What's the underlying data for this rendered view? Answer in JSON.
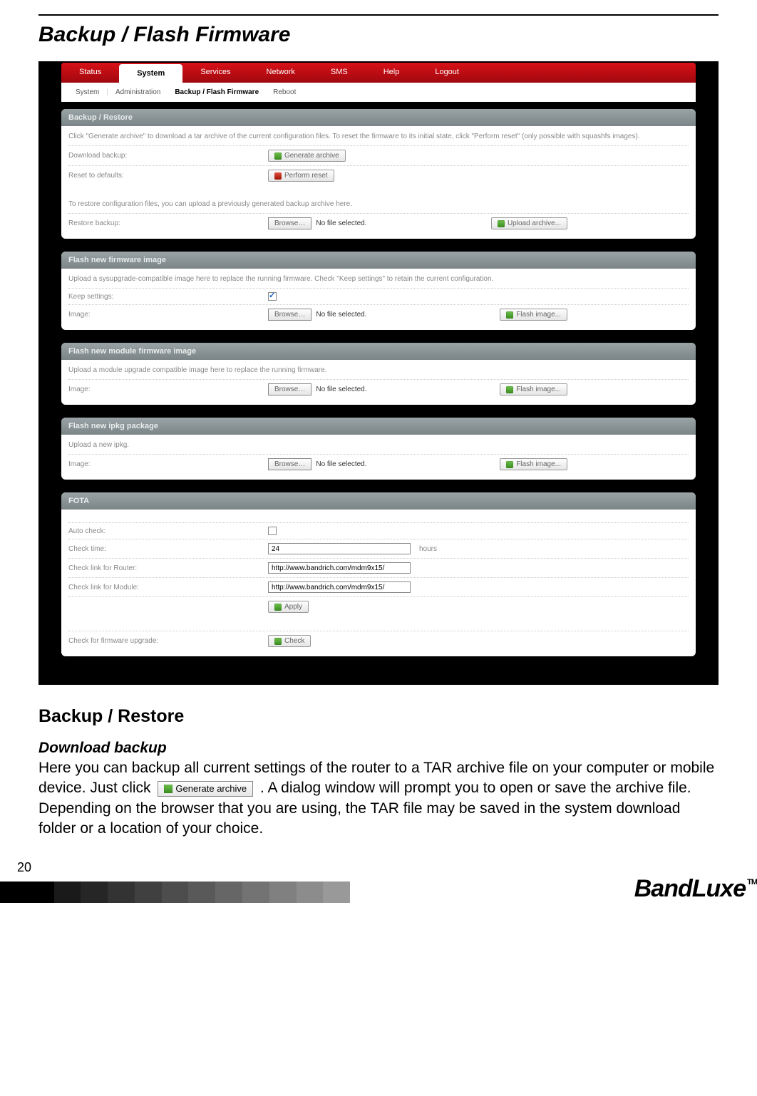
{
  "page": {
    "title": "Backup / Flash Firmware",
    "number": "20"
  },
  "nav": {
    "tabs": [
      "Status",
      "System",
      "Services",
      "Network",
      "SMS",
      "Help",
      "Logout"
    ],
    "active_tab": "System",
    "subtabs": {
      "system": "System",
      "admin": "Administration",
      "backup": "Backup / Flash Firmware",
      "reboot": "Reboot"
    }
  },
  "backup_restore": {
    "head": "Backup / Restore",
    "hint": "Click \"Generate archive\" to download a tar archive of the current configuration files. To reset the firmware to its initial state, click \"Perform reset\" (only possible with squashfs images).",
    "download_label": "Download backup:",
    "generate_btn": "Generate archive",
    "reset_label": "Reset to defaults:",
    "reset_btn": "Perform reset",
    "restore_hint": "To restore configuration files, you can upload a previously generated backup archive here.",
    "restore_label": "Restore backup:",
    "browse": "Browse…",
    "nofile": "No file selected.",
    "upload_btn": "Upload archive..."
  },
  "flash_fw": {
    "head": "Flash new firmware image",
    "hint": "Upload a sysupgrade-compatible image here to replace the running firmware. Check \"Keep settings\" to retain the current configuration.",
    "keep_label": "Keep settings:",
    "image_label": "Image:",
    "browse": "Browse…",
    "nofile": "No file selected.",
    "flash_btn": "Flash image..."
  },
  "flash_module": {
    "head": "Flash new module firmware image",
    "hint": "Upload a module upgrade compatible image here to replace the running firmware.",
    "image_label": "Image:",
    "browse": "Browse…",
    "nofile": "No file selected.",
    "flash_btn": "Flash image..."
  },
  "flash_ipkg": {
    "head": "Flash new ipkg package",
    "hint": "Upload a new ipkg.",
    "image_label": "Image:",
    "browse": "Browse…",
    "nofile": "No file selected.",
    "flash_btn": "Flash image..."
  },
  "fota": {
    "head": "FOTA",
    "auto_check_label": "Auto check:",
    "check_time_label": "Check time:",
    "check_time_value": "24",
    "check_time_unit": "hours",
    "router_link_label": "Check link for Router:",
    "router_link_value": "http://www.bandrich.com/mdm9x15/",
    "module_link_label": "Check link for Module:",
    "module_link_value": "http://www.bandrich.com/mdm9x15/",
    "apply_btn": "Apply",
    "upgrade_label": "Check for firmware upgrade:",
    "check_btn": "Check"
  },
  "doc": {
    "h2": "Backup / Restore",
    "h3": "Download backup",
    "p1a": "Here you can backup all current settings of the router to a TAR archive file on your computer or mobile device. Just click ",
    "p1btn": "Generate archive",
    "p1b": " . A dialog window will prompt you to open or save the archive file. Depending on the browser that you are using, the TAR file may be saved in the system download folder or a location of your choice."
  },
  "brand": "BandLuxe",
  "strip_colors": [
    "#000000",
    "#000000",
    "#1a1a1a",
    "#262626",
    "#333333",
    "#404040",
    "#4d4d4d",
    "#595959",
    "#666666",
    "#737373",
    "#808080",
    "#8c8c8c",
    "#999999",
    "#ffffff",
    "#ffffff",
    "#ffffff",
    "#ffffff",
    "#ffffff"
  ]
}
